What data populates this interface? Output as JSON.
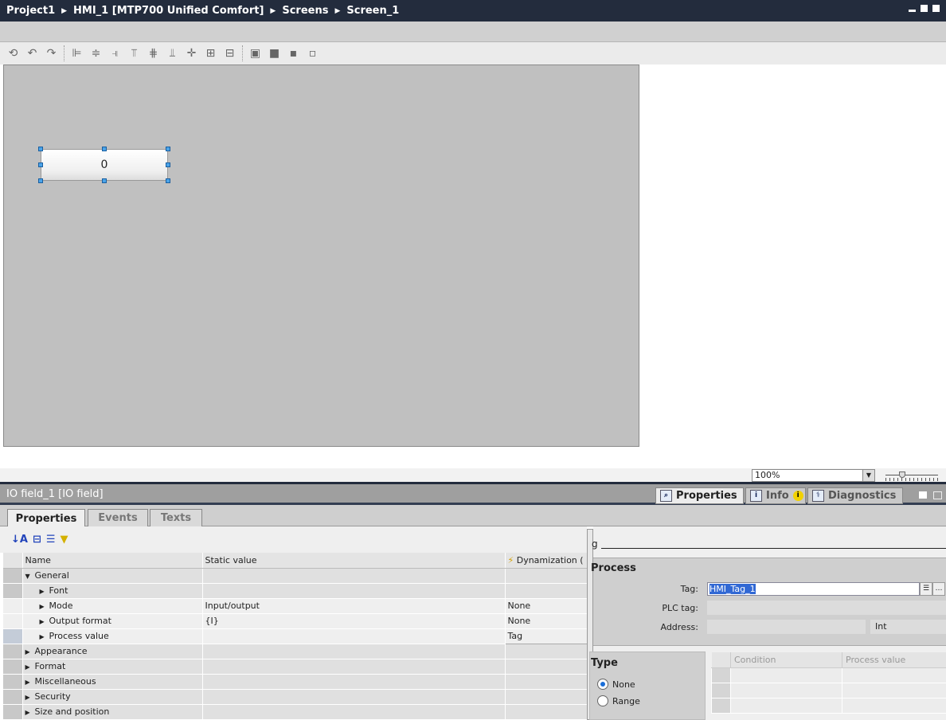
{
  "breadcrumb": [
    "Project1",
    "HMI_1 [MTP700 Unified Comfort]",
    "Screens",
    "Screen_1"
  ],
  "toolbar_icons": [
    "rotate-left-icon",
    "rotate-ccw-icon",
    "rotate-cw-icon",
    "align-left-icon",
    "align-center-icon",
    "align-right-icon",
    "align-top-icon",
    "align-middle-icon",
    "align-bottom-icon",
    "center-icon",
    "center-horizontal-icon",
    "center-vertical-icon",
    "bring-to-front-icon",
    "bring-forward-icon",
    "send-backward-icon",
    "send-to-back-icon"
  ],
  "canvas": {
    "io_field_value": "0",
    "zoom": "100%"
  },
  "panel": {
    "title": "IO field_1 [IO field]",
    "right_tabs": [
      {
        "label": "Properties"
      },
      {
        "label": "Info"
      },
      {
        "label": "Diagnostics"
      }
    ],
    "tabs": [
      "Properties",
      "Events",
      "Texts"
    ],
    "columns": [
      "Name",
      "Static value",
      "Dynamization ("
    ],
    "rows": [
      {
        "name": "General",
        "static": "",
        "dyn": "",
        "level": 0,
        "expanded": true
      },
      {
        "name": "Font",
        "static": "",
        "dyn": "",
        "level": 1
      },
      {
        "name": "Mode",
        "static": "Input/output",
        "dyn": "None",
        "level": 1
      },
      {
        "name": "Output format",
        "static": "{I}",
        "dyn": "None",
        "level": 1
      },
      {
        "name": "Process value",
        "static": "",
        "dyn": "Tag",
        "level": 1
      },
      {
        "name": "Appearance",
        "static": "",
        "dyn": "",
        "level": 0
      },
      {
        "name": "Format",
        "static": "",
        "dyn": "",
        "level": 0
      },
      {
        "name": "Miscellaneous",
        "static": "",
        "dyn": "",
        "level": 0
      },
      {
        "name": "Security",
        "static": "",
        "dyn": "",
        "level": 0
      },
      {
        "name": "Size and position",
        "static": "",
        "dyn": "",
        "level": 0
      }
    ]
  },
  "dynamization": {
    "header_fragment": "g",
    "process_title": "Process",
    "tag_label": "Tag:",
    "tag_value": "HMI_Tag_1",
    "plc_tag_label": "PLC tag:",
    "plc_tag_value": "",
    "address_label": "Address:",
    "address_value": "",
    "data_type": "Int",
    "type_title": "Type",
    "type_options": [
      {
        "label": "None",
        "selected": true
      },
      {
        "label": "Range",
        "selected": false
      }
    ],
    "table_columns": [
      "Condition",
      "Process value"
    ]
  }
}
